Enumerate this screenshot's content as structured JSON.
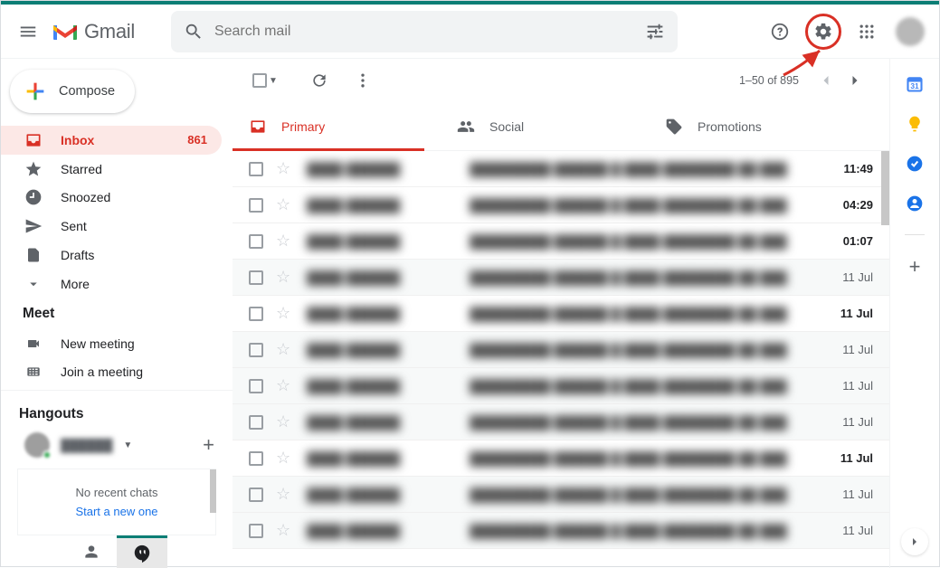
{
  "header": {
    "app_name": "Gmail",
    "search_placeholder": "Search mail"
  },
  "compose_label": "Compose",
  "sidebar": {
    "items": [
      {
        "label": "Inbox",
        "count": "861"
      },
      {
        "label": "Starred"
      },
      {
        "label": "Snoozed"
      },
      {
        "label": "Sent"
      },
      {
        "label": "Drafts"
      },
      {
        "label": "More"
      }
    ],
    "meet_header": "Meet",
    "meet_items": [
      {
        "label": "New meeting"
      },
      {
        "label": "Join a meeting"
      }
    ],
    "hangouts_header": "Hangouts",
    "no_recent_chats": "No recent chats",
    "start_new": "Start a new one"
  },
  "toolbar": {
    "range": "1–50 of 895"
  },
  "tabs": [
    {
      "label": "Primary"
    },
    {
      "label": "Social"
    },
    {
      "label": "Promotions"
    }
  ],
  "mails": [
    {
      "time": "11:49",
      "unread": true
    },
    {
      "time": "04:29",
      "unread": true
    },
    {
      "time": "01:07",
      "unread": true
    },
    {
      "time": "11 Jul",
      "unread": false
    },
    {
      "time": "11 Jul",
      "unread": true
    },
    {
      "time": "11 Jul",
      "unread": false
    },
    {
      "time": "11 Jul",
      "unread": false
    },
    {
      "time": "11 Jul",
      "unread": false
    },
    {
      "time": "11 Jul",
      "unread": true
    },
    {
      "time": "11 Jul",
      "unread": false
    },
    {
      "time": "11 Jul",
      "unread": false
    }
  ]
}
